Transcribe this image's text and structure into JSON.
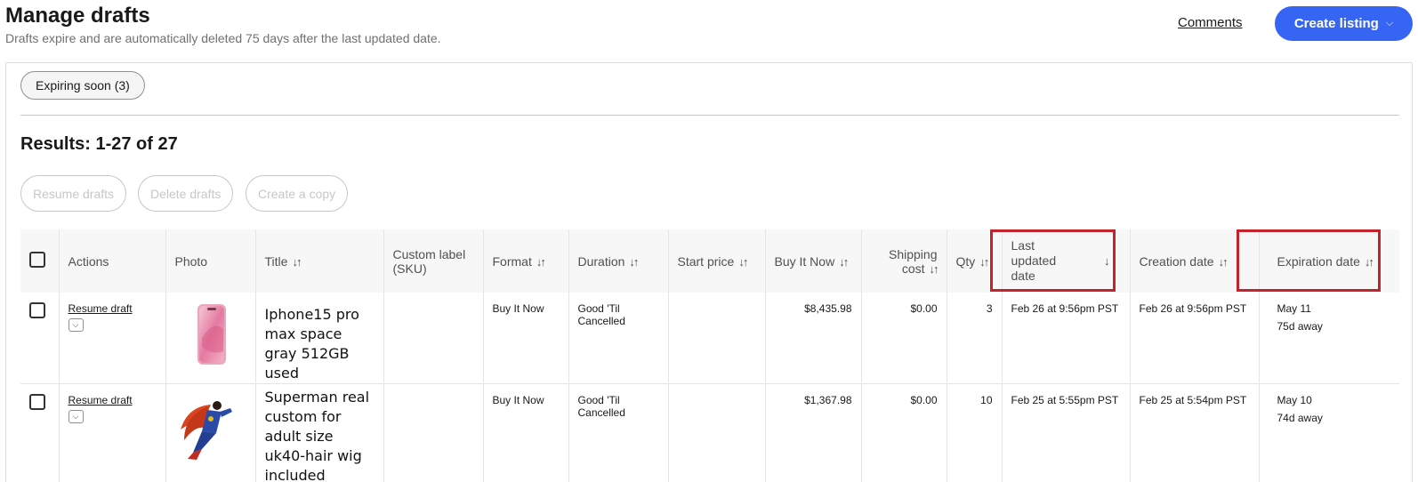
{
  "header": {
    "title": "Manage drafts",
    "subtitle": "Drafts expire and are automatically deleted 75 days after the last updated date.",
    "comments_link": "Comments",
    "create_button": "Create listing",
    "create_chevron": "⌵"
  },
  "filters": {
    "expiring_chip": "Expiring soon (3)"
  },
  "results": {
    "title": "Results: 1-27 of 27",
    "buttons": [
      "Resume drafts",
      "Delete drafts",
      "Create a copy"
    ]
  },
  "table": {
    "columns": {
      "actions": "Actions",
      "photo": "Photo",
      "title": "Title",
      "sku": "Custom label (SKU)",
      "format": "Format",
      "duration": "Duration",
      "start_price": "Start price",
      "buy_it_now": "Buy It Now",
      "shipping": "Shipping cost",
      "qty": "Qty",
      "last_updated": "Last updated date",
      "creation": "Creation date",
      "expiration": "Expiration date"
    },
    "sort_icon": "↓↑",
    "sorted_icon": "↓",
    "rows": [
      {
        "action": "Resume draft",
        "photo_icon": "phone-photo",
        "title": "Iphone15 pro max space gray 512GB used",
        "sku": "",
        "format": "Buy It Now",
        "duration": "Good 'Til Cancelled",
        "start_price": "",
        "buy_it_now": "$8,435.98",
        "shipping": "$0.00",
        "qty": "3",
        "last_updated": "Feb 26 at 9:56pm PST",
        "creation": "Feb 26 at 9:56pm PST",
        "expiration": "May 11",
        "expiration_away": "75d away"
      },
      {
        "action": "Resume draft",
        "photo_icon": "superhero-costume-photo",
        "title": "Superman real custom for adult size uk40-hair wig included",
        "sku": "",
        "format": "Buy It Now",
        "duration": "Good 'Til Cancelled",
        "start_price": "",
        "buy_it_now": "$1,367.98",
        "shipping": "$0.00",
        "qty": "10",
        "last_updated": "Feb 25 at 5:55pm PST",
        "creation": "Feb 25 at 5:54pm PST",
        "expiration": "May 10",
        "expiration_away": "74d away"
      }
    ]
  },
  "colors": {
    "accent": "#3665f3",
    "highlight": "#c4232b"
  }
}
